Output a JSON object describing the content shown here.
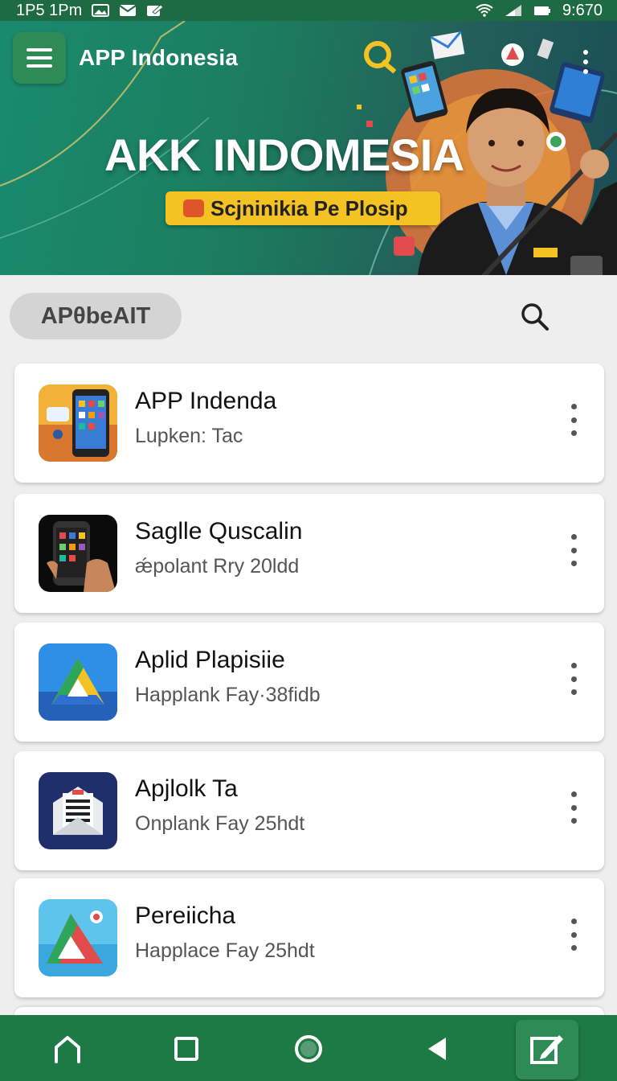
{
  "status_bar": {
    "left_text": "1P5 1Pm",
    "time": "9:670",
    "icons": [
      "gallery-icon",
      "mail-icon",
      "edit-icon",
      "wifi-icon",
      "signal-icon",
      "battery-icon"
    ]
  },
  "header": {
    "title": "APP Indonesia",
    "menu_icon": "hamburger-menu-icon",
    "overflow_icon": "more-vertical-icon"
  },
  "banner": {
    "title": "AKK INDOMESIA",
    "pill_text": "Scjninikia Pe Plosip"
  },
  "filter": {
    "chip_label": "APθbeAIT",
    "search_icon": "search-icon"
  },
  "apps": [
    {
      "name": "APP Indenda",
      "subtitle": "Lupken: Tac",
      "icon": "phone-apps-icon"
    },
    {
      "name": "Saglle Quscalin",
      "subtitle": "ǽpolant Rry 20ldd",
      "icon": "hand-phone-icon"
    },
    {
      "name": "Aplid Plapisiie",
      "subtitle": "Happlank Fay·38fidb",
      "icon": "drive-triangle-icon"
    },
    {
      "name": "Apjlolk Ta",
      "subtitle": "Onplank Fay 25hdt",
      "icon": "document-envelope-icon"
    },
    {
      "name": "Pereiicha",
      "subtitle": "Happlace Fay 25hdt",
      "icon": "drive-triangle-red-icon"
    }
  ],
  "bottom_nav": {
    "icons": [
      "home-icon",
      "recents-square-icon",
      "circle-home-icon",
      "back-triangle-icon",
      "compose-icon"
    ]
  },
  "colors": {
    "status_bar": "#1e6b43",
    "brand_green": "#2e8b55",
    "nav_green": "#1e7a44",
    "accent_yellow": "#f5c224"
  }
}
